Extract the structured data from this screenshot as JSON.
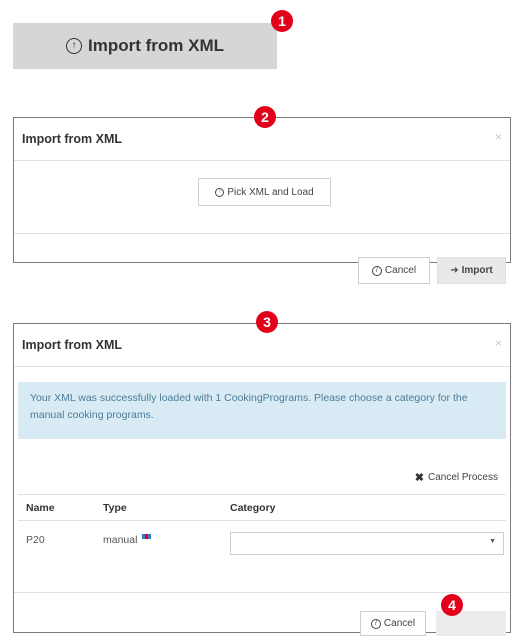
{
  "step_badges": [
    "1",
    "2",
    "3",
    "4"
  ],
  "import_button": {
    "label": "Import from XML",
    "icon": "upload-circle-icon"
  },
  "dialog1": {
    "title": "Import from XML",
    "close": "×",
    "pick_button": "Pick XML and Load",
    "cancel_button": "Cancel",
    "import_button": "Import"
  },
  "dialog2": {
    "title": "Import from XML",
    "close": "×",
    "alert": "Your XML was successfully loaded with 1 CookingPrograms. Please choose a category for the manual cooking programs.",
    "cancel_process": "Cancel Process",
    "table": {
      "headers": {
        "name": "Name",
        "type": "Type",
        "category": "Category"
      },
      "rows": [
        {
          "name": "P20",
          "type": "manual",
          "category": ""
        }
      ]
    },
    "cancel_button": "Cancel",
    "import_button": ""
  },
  "colors": {
    "badge": "#e3001b",
    "alert_bg": "#d8ebf5",
    "alert_text": "#4d7b96",
    "button_grey": "#d6d6d6"
  }
}
